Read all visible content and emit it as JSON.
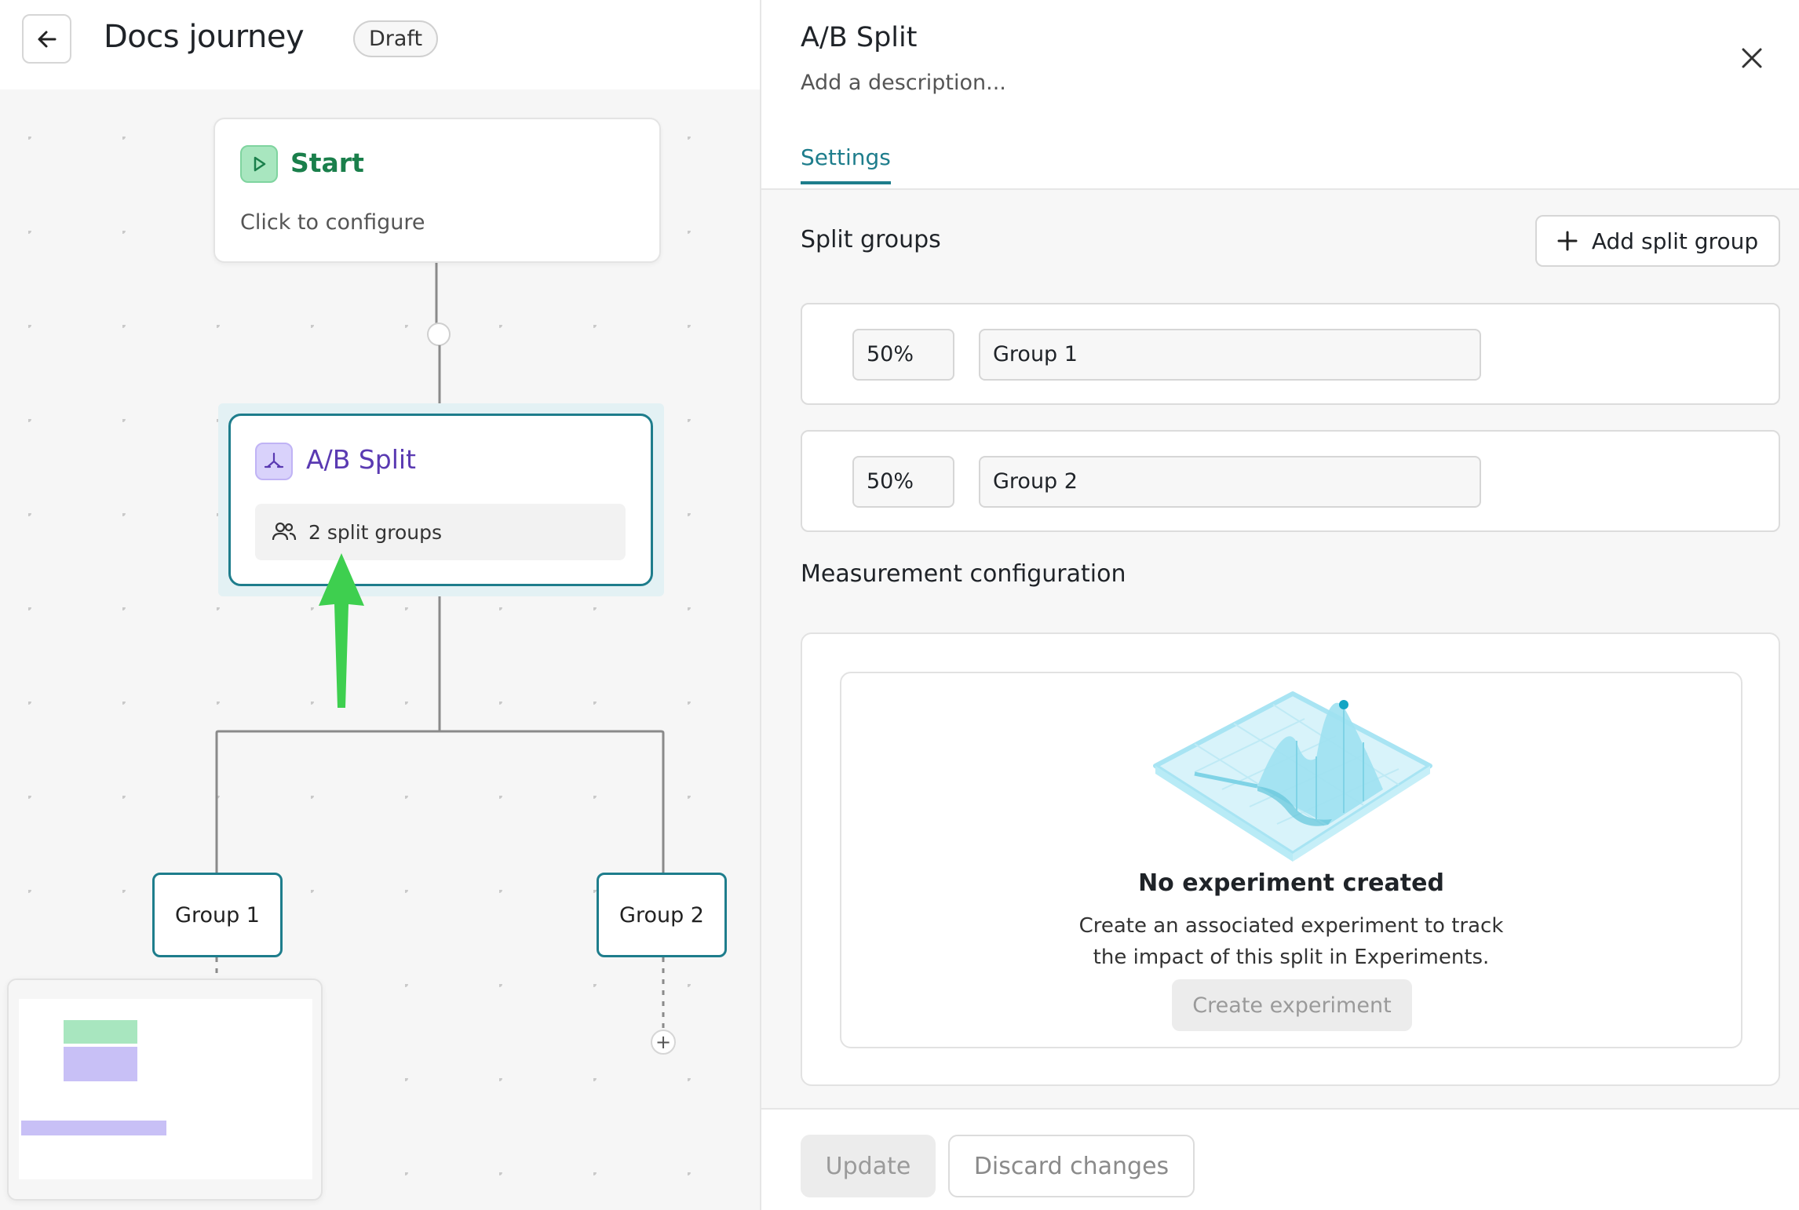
{
  "header": {
    "title": "Docs journey",
    "status_badge": "Draft"
  },
  "canvas": {
    "start_node": {
      "label": "Start",
      "subtitle": "Click to configure"
    },
    "split_node": {
      "label": "A/B Split",
      "groups_summary": "2 split groups"
    },
    "group_nodes": [
      "Group 1",
      "Group 2"
    ],
    "add_step_symbol": "+"
  },
  "panel": {
    "title": "A/B Split",
    "description_placeholder": "Add a description...",
    "tabs": [
      {
        "label": "Settings",
        "active": true
      }
    ],
    "split_groups": {
      "title": "Split groups",
      "add_button": "Add split group",
      "groups": [
        {
          "percent": "50%",
          "name": "Group 1"
        },
        {
          "percent": "50%",
          "name": "Group 2"
        }
      ]
    },
    "measurement": {
      "title": "Measurement configuration",
      "empty_title": "No experiment created",
      "empty_line1": "Create an associated experiment to track",
      "empty_line2": "the impact of this split in Experiments.",
      "create_button": "Create experiment"
    },
    "footer": {
      "update_button": "Update",
      "discard_button": "Discard changes"
    }
  },
  "colors": {
    "accent": "#1e7d8c",
    "start_green": "#1a7f4b",
    "split_purple": "#5a3ab2",
    "annotation_arrow": "#3ecf4f"
  }
}
